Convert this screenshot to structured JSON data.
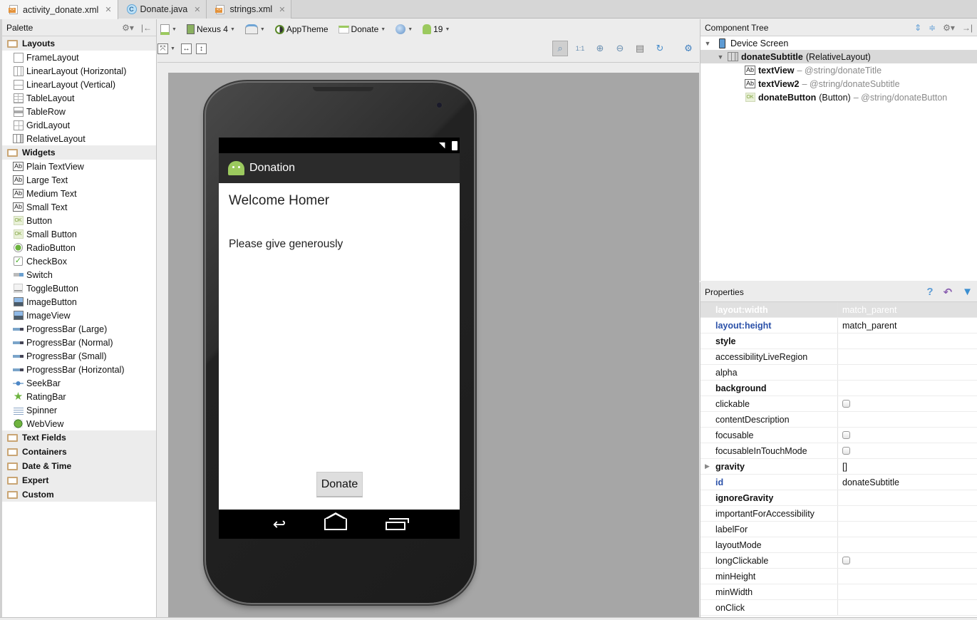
{
  "tabs": [
    {
      "label": "activity_donate.xml",
      "icon": "xml-file-icon",
      "active": true
    },
    {
      "label": "Donate.java",
      "icon": "java-class-icon",
      "active": false
    },
    {
      "label": "strings.xml",
      "icon": "xml-file-icon",
      "active": false
    }
  ],
  "palette": {
    "title": "Palette",
    "categories": {
      "layouts": {
        "label": "Layouts",
        "items": [
          "FrameLayout",
          "LinearLayout (Horizontal)",
          "LinearLayout (Vertical)",
          "TableLayout",
          "TableRow",
          "GridLayout",
          "RelativeLayout"
        ]
      },
      "widgets": {
        "label": "Widgets",
        "items": [
          "Plain TextView",
          "Large Text",
          "Medium Text",
          "Small Text",
          "Button",
          "Small Button",
          "RadioButton",
          "CheckBox",
          "Switch",
          "ToggleButton",
          "ImageButton",
          "ImageView",
          "ProgressBar (Large)",
          "ProgressBar (Normal)",
          "ProgressBar (Small)",
          "ProgressBar (Horizontal)",
          "SeekBar",
          "RatingBar",
          "Spinner",
          "WebView"
        ]
      },
      "collapsed": [
        "Text Fields",
        "Containers",
        "Date & Time",
        "Expert",
        "Custom"
      ]
    }
  },
  "toolbar": {
    "device": "Nexus 4",
    "theme": "AppTheme",
    "activity": "Donate",
    "api_level": "19"
  },
  "zoom_tools": [
    "zoom-to-fit-icon",
    "actual-size-icon",
    "zoom-in-icon",
    "zoom-out-icon",
    "screenshot-icon",
    "refresh-icon",
    "settings-icon"
  ],
  "device_preview": {
    "app_title": "Donation",
    "welcome_text": "Welcome Homer",
    "subtitle_text": "Please give generously",
    "button_label": "Donate"
  },
  "component_tree": {
    "title": "Component Tree",
    "root": "Device Screen",
    "layout": {
      "id": "donateSubtitle",
      "type": "(RelativeLayout)"
    },
    "children": [
      {
        "id": "textView",
        "type": "",
        "ref": "– @string/donateTitle",
        "icon": "Ab"
      },
      {
        "id": "textView2",
        "type": "",
        "ref": "– @string/donateSubtitle",
        "icon": "Ab"
      },
      {
        "id": "donateButton",
        "type": "(Button)",
        "ref": "– @string/donateButton",
        "icon": "OK"
      }
    ]
  },
  "properties": {
    "title": "Properties",
    "rows": [
      {
        "name": "layout:width",
        "value": "match_parent"
      },
      {
        "name": "layout:height",
        "value": "match_parent"
      },
      {
        "name": "style",
        "value": ""
      },
      {
        "name": "accessibilityLiveRegion",
        "value": ""
      },
      {
        "name": "alpha",
        "value": ""
      },
      {
        "name": "background",
        "value": ""
      },
      {
        "name": "clickable",
        "value": ""
      },
      {
        "name": "contentDescription",
        "value": ""
      },
      {
        "name": "focusable",
        "value": ""
      },
      {
        "name": "focusableInTouchMode",
        "value": ""
      },
      {
        "name": "gravity",
        "value": "[]"
      },
      {
        "name": "id",
        "value": "donateSubtitle"
      },
      {
        "name": "ignoreGravity",
        "value": ""
      },
      {
        "name": "importantForAccessibility",
        "value": ""
      },
      {
        "name": "labelFor",
        "value": ""
      },
      {
        "name": "layoutMode",
        "value": ""
      },
      {
        "name": "longClickable",
        "value": ""
      },
      {
        "name": "minHeight",
        "value": ""
      },
      {
        "name": "minWidth",
        "value": ""
      },
      {
        "name": "onClick",
        "value": ""
      }
    ]
  }
}
